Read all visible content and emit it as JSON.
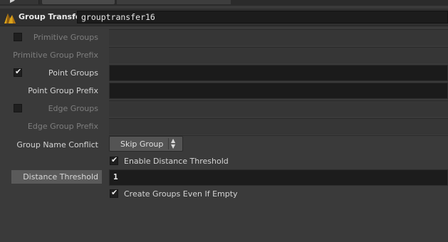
{
  "header": {
    "node_type": "Group Transfer",
    "node_name": "grouptransfer16"
  },
  "params": {
    "primitive_groups": {
      "label": "Primitive Groups",
      "checked": false
    },
    "primitive_group_prefix": {
      "label": "Primitive Group Prefix",
      "value": ""
    },
    "point_groups": {
      "label": "Point Groups",
      "checked": true,
      "value": ""
    },
    "point_group_prefix": {
      "label": "Point Group Prefix",
      "value": ""
    },
    "edge_groups": {
      "label": "Edge Groups",
      "checked": false
    },
    "edge_group_prefix": {
      "label": "Edge Group Prefix",
      "value": ""
    },
    "group_name_conflict": {
      "label": "Group Name Conflict",
      "value": "Skip Group"
    },
    "enable_distance_threshold": {
      "label": "Enable Distance Threshold",
      "checked": true
    },
    "distance_threshold": {
      "label": "Distance Threshold",
      "value": "1"
    },
    "create_groups_even_if_empty": {
      "label": "Create Groups Even If Empty",
      "checked": true
    }
  },
  "icons": {
    "node": "houdini-node-icon",
    "menu_arrows": "updown-arrows-icon",
    "checkmark": "checkmark-icon"
  },
  "colors": {
    "panel_bg": "#3a3a3a",
    "field_bg": "#1c1c1c",
    "button_bg": "#545454",
    "highlight_label_bg": "#5a5a5a"
  }
}
